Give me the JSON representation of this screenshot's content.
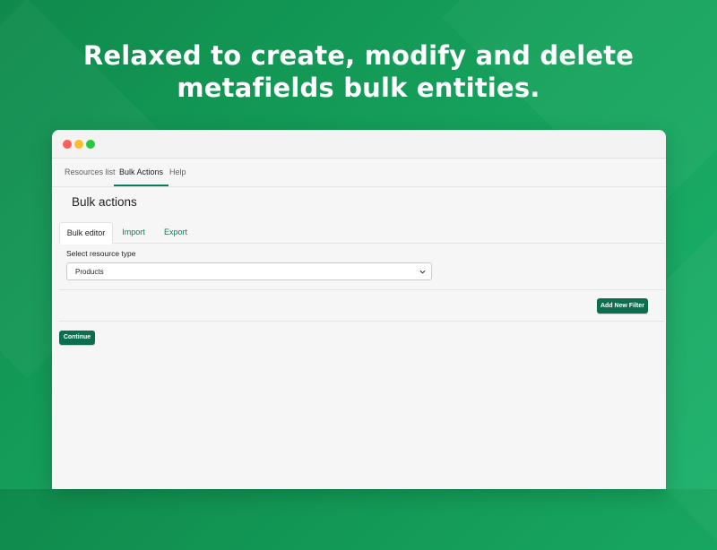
{
  "headline": {
    "line1": "Relaxed to create, modify and delete",
    "line2": "metafields bulk entities."
  },
  "nav": {
    "items": [
      "Resources list",
      "Bulk Actions",
      "Help"
    ],
    "active": "Bulk Actions"
  },
  "page": {
    "title": "Bulk actions"
  },
  "tabs": {
    "items": [
      "Bulk editor",
      "Import",
      "Export"
    ],
    "active": "Bulk editor"
  },
  "resource_type": {
    "label": "Select resource type",
    "selected": "Products"
  },
  "buttons": {
    "add_filter": "Add New Filter",
    "continue": "Continue"
  },
  "colors": {
    "background": "#16a35d",
    "accent": "#0c6e4f",
    "tab_link": "#0c7a5c"
  }
}
